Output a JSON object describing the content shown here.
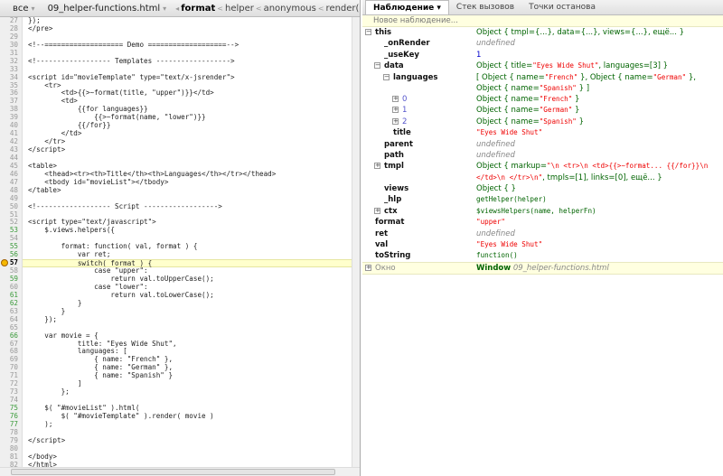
{
  "toolbar": {
    "all_label": "все",
    "file_label": "09_helper-functions.html",
    "breadcrumbs": [
      "format",
      "helper",
      "anonymous",
      "render("
    ],
    "icons": [
      "pause-icon",
      "rerun-icon",
      "continue-icon",
      "step-over-icon",
      "step-into-icon",
      "step-out-icon"
    ]
  },
  "code": {
    "current_line": 57,
    "lines": [
      {
        "n": 27,
        "t": "});",
        "ex": false
      },
      {
        "n": 28,
        "t": "</pre>",
        "ex": false
      },
      {
        "n": 29,
        "t": "",
        "ex": false
      },
      {
        "n": 30,
        "t": "<!--=================== Demo ===================-->",
        "ex": false
      },
      {
        "n": 31,
        "t": "",
        "ex": false
      },
      {
        "n": 32,
        "t": "<!------------------ Templates ------------------>",
        "ex": false
      },
      {
        "n": 33,
        "t": "",
        "ex": false
      },
      {
        "n": 34,
        "t": "<script id=\"movieTemplate\" type=\"text/x-jsrender\">",
        "ex": false
      },
      {
        "n": 35,
        "t": "    <tr>",
        "ex": false
      },
      {
        "n": 36,
        "t": "        <td>{{>~format(title, \"upper\")}}</td>",
        "ex": false
      },
      {
        "n": 37,
        "t": "        <td>",
        "ex": false
      },
      {
        "n": 38,
        "t": "            {{for languages}}",
        "ex": false
      },
      {
        "n": 39,
        "t": "                {{>~format(name, \"lower\")}}",
        "ex": false
      },
      {
        "n": 40,
        "t": "            {{/for}}",
        "ex": false
      },
      {
        "n": 41,
        "t": "        </td>",
        "ex": false
      },
      {
        "n": 42,
        "t": "    </tr>",
        "ex": false
      },
      {
        "n": 43,
        "t": "</script>",
        "ex": false
      },
      {
        "n": 44,
        "t": "",
        "ex": false
      },
      {
        "n": 45,
        "t": "<table>",
        "ex": false
      },
      {
        "n": 46,
        "t": "    <thead><tr><th>Title</th><th>Languages</th></tr></thead>",
        "ex": false
      },
      {
        "n": 47,
        "t": "    <tbody id=\"movieList\"></tbody>",
        "ex": false
      },
      {
        "n": 48,
        "t": "</table>",
        "ex": false
      },
      {
        "n": 49,
        "t": "",
        "ex": false
      },
      {
        "n": 50,
        "t": "<!------------------ Script ------------------>",
        "ex": false
      },
      {
        "n": 51,
        "t": "",
        "ex": false
      },
      {
        "n": 52,
        "t": "<script type=\"text/javascript\">",
        "ex": false
      },
      {
        "n": 53,
        "t": "    $.views.helpers({",
        "ex": true
      },
      {
        "n": 54,
        "t": "",
        "ex": false
      },
      {
        "n": 55,
        "t": "        format: function( val, format ) {",
        "ex": true
      },
      {
        "n": 56,
        "t": "            var ret;",
        "ex": true
      },
      {
        "n": 57,
        "t": "            switch( format ) {",
        "ex": true
      },
      {
        "n": 58,
        "t": "                case \"upper\":",
        "ex": false
      },
      {
        "n": 59,
        "t": "                    return val.toUpperCase();",
        "ex": true
      },
      {
        "n": 60,
        "t": "                case \"lower\":",
        "ex": false
      },
      {
        "n": 61,
        "t": "                    return val.toLowerCase();",
        "ex": true
      },
      {
        "n": 62,
        "t": "            }",
        "ex": true
      },
      {
        "n": 63,
        "t": "        }",
        "ex": false
      },
      {
        "n": 64,
        "t": "    });",
        "ex": false
      },
      {
        "n": 65,
        "t": "",
        "ex": false
      },
      {
        "n": 66,
        "t": "    var movie = {",
        "ex": true
      },
      {
        "n": 67,
        "t": "            title: \"Eyes Wide Shut\",",
        "ex": false
      },
      {
        "n": 68,
        "t": "            languages: [",
        "ex": false
      },
      {
        "n": 69,
        "t": "                { name: \"French\" },",
        "ex": false
      },
      {
        "n": 70,
        "t": "                { name: \"German\" },",
        "ex": false
      },
      {
        "n": 71,
        "t": "                { name: \"Spanish\" }",
        "ex": false
      },
      {
        "n": 72,
        "t": "            ]",
        "ex": false
      },
      {
        "n": 73,
        "t": "        };",
        "ex": false
      },
      {
        "n": 74,
        "t": "",
        "ex": false
      },
      {
        "n": 75,
        "t": "    $( \"#movieList\" ).html(",
        "ex": true
      },
      {
        "n": 76,
        "t": "        $( \"#movieTemplate\" ).render( movie )",
        "ex": true
      },
      {
        "n": 77,
        "t": "    );",
        "ex": true
      },
      {
        "n": 78,
        "t": "",
        "ex": false
      },
      {
        "n": 79,
        "t": "</script>",
        "ex": false
      },
      {
        "n": 80,
        "t": "",
        "ex": false
      },
      {
        "n": 81,
        "t": "</body>",
        "ex": false
      },
      {
        "n": 82,
        "t": "</html>",
        "ex": false
      }
    ]
  },
  "panel": {
    "tabs": [
      "Наблюдение",
      "Стек вызовов",
      "Точки останова"
    ],
    "new_watch_placeholder": "Новое наблюдение...",
    "watch": [
      {
        "label": "this",
        "level": 0,
        "toggle": "minus",
        "value": [
          [
            "obj",
            "Object { "
          ],
          [
            "obj",
            "tmpl={...},  data={...},  views={...},  ещё... }"
          ]
        ]
      },
      {
        "label": "_onRender",
        "level": 1,
        "toggle": "",
        "value": [
          [
            "undef",
            "undefined"
          ]
        ]
      },
      {
        "label": "_useKey",
        "level": 1,
        "toggle": "",
        "value": [
          [
            "num",
            "1"
          ]
        ]
      },
      {
        "label": "data",
        "level": 1,
        "toggle": "minus",
        "value": [
          [
            "obj",
            "Object {  title="
          ],
          [
            "str",
            "\"Eyes Wide Shut\""
          ],
          [
            "obj",
            ",  languages=[3] }"
          ]
        ]
      },
      {
        "label": "languages",
        "level": 2,
        "toggle": "minus",
        "value": [
          [
            "obj",
            "[ Object {  name="
          ],
          [
            "str",
            "\"French\""
          ],
          [
            "obj",
            " }, Object {  name="
          ],
          [
            "str",
            "\"German\""
          ],
          [
            "obj",
            " }, Object {  name="
          ],
          [
            "str",
            "\"Spanish\""
          ],
          [
            "obj",
            " } ]"
          ]
        ]
      },
      {
        "label": "0",
        "level": 3,
        "toggle": "plus",
        "idx": true,
        "value": [
          [
            "obj",
            "Object {  name="
          ],
          [
            "str",
            "\"French\""
          ],
          [
            "obj",
            " }"
          ]
        ]
      },
      {
        "label": "1",
        "level": 3,
        "toggle": "plus",
        "idx": true,
        "value": [
          [
            "obj",
            "Object {  name="
          ],
          [
            "str",
            "\"German\""
          ],
          [
            "obj",
            " }"
          ]
        ]
      },
      {
        "label": "2",
        "level": 3,
        "toggle": "plus",
        "idx": true,
        "value": [
          [
            "obj",
            "Object {  name="
          ],
          [
            "str",
            "\"Spanish\""
          ],
          [
            "obj",
            " }"
          ]
        ]
      },
      {
        "label": "title",
        "level": 2,
        "toggle": "",
        "value": [
          [
            "str",
            "\"Eyes Wide Shut\""
          ]
        ]
      },
      {
        "label": "parent",
        "level": 1,
        "toggle": "",
        "value": [
          [
            "undef",
            "undefined"
          ]
        ]
      },
      {
        "label": "path",
        "level": 1,
        "toggle": "",
        "value": [
          [
            "undef",
            "undefined"
          ]
        ]
      },
      {
        "label": "tmpl",
        "level": 1,
        "toggle": "plus",
        "value": [
          [
            "obj",
            "Object {  markup="
          ],
          [
            "str",
            "\"\\n        <tr>\\n            <td>{{>~format... {{/for}}\\n            </td>\\n </tr>\\n\""
          ],
          [
            "obj",
            ",  tmpls=[1],  links=[0],  ещё... }"
          ]
        ]
      },
      {
        "label": "views",
        "level": 1,
        "toggle": "",
        "value": [
          [
            "obj",
            "Object {  }"
          ]
        ]
      },
      {
        "label": "_hlp",
        "level": 1,
        "toggle": "",
        "value": [
          [
            "fn",
            "getHelper(helper)"
          ]
        ]
      },
      {
        "label": "ctx",
        "level": 1,
        "toggle": "plus",
        "value": [
          [
            "fn",
            "$viewsHelpers(name, helperFn)"
          ]
        ]
      },
      {
        "label": "format",
        "level": 0,
        "toggle": "",
        "value": [
          [
            "str",
            "\"upper\""
          ]
        ]
      },
      {
        "label": "ret",
        "level": 0,
        "toggle": "",
        "value": [
          [
            "undef",
            "undefined"
          ]
        ]
      },
      {
        "label": "val",
        "level": 0,
        "toggle": "",
        "value": [
          [
            "str",
            "\"Eyes Wide Shut\""
          ]
        ]
      },
      {
        "label": "toString",
        "level": 0,
        "toggle": "",
        "value": [
          [
            "fn",
            "function()"
          ]
        ]
      }
    ],
    "window_row": {
      "label": "Окно",
      "value_bold": "Window",
      "value_file": "09_helper-functions.html"
    }
  }
}
